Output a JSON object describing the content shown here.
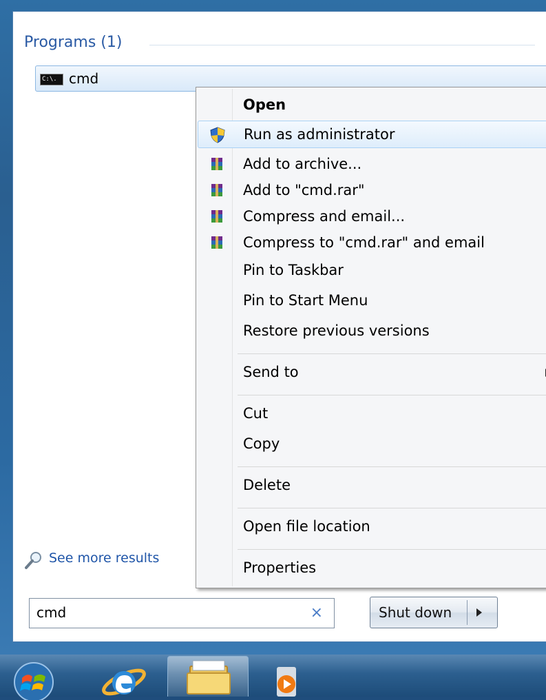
{
  "search": {
    "section_header": "Programs (1)",
    "program_label": "cmd",
    "cmd_icon_text": "C:\\.",
    "see_more": "See more results",
    "query": "cmd",
    "clear_glyph": "×"
  },
  "shutdown": {
    "label": "Shut down"
  },
  "context_menu": {
    "open": "Open",
    "run_as_admin": "Run as administrator",
    "add_to_archive": "Add to archive...",
    "add_to_rar": "Add to \"cmd.rar\"",
    "compress_email": "Compress and email...",
    "compress_rar_email": "Compress to \"cmd.rar\" and email",
    "pin_taskbar": "Pin to Taskbar",
    "pin_start": "Pin to Start Menu",
    "restore": "Restore previous versions",
    "send_to": "Send to",
    "cut": "Cut",
    "copy": "Copy",
    "delete": "Delete",
    "open_location": "Open file location",
    "properties": "Properties"
  },
  "icons": {
    "program": "cmd-icon",
    "uac": "uac-shield-icon",
    "archive": "winrar-icon",
    "search": "search-icon",
    "orb": "start-orb-icon",
    "ie": "internet-explorer-icon",
    "explorer": "folder-icon",
    "media": "media-player-icon"
  },
  "colors": {
    "accent": "#2a5aa4",
    "hover_border": "#a9d1f5",
    "taskbar": "#2c5f8f"
  }
}
